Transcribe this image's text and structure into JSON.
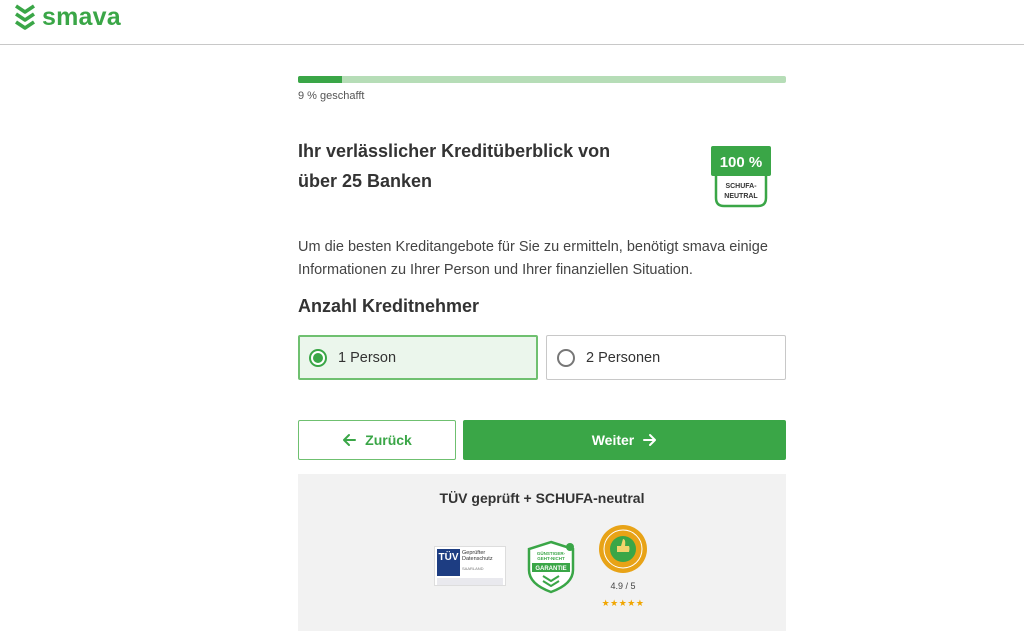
{
  "brand": {
    "name": "smava",
    "accent_color": "#3aa647",
    "light_accent": "#b6ddb7",
    "icon": "smava-chevrons-logo"
  },
  "progress": {
    "percent": 9,
    "label": "9 % geschafft"
  },
  "headline": {
    "line1": "Ihr verlässlicher Kreditüberblick von",
    "line2": "über 25 Banken"
  },
  "badge": {
    "value": "100 %",
    "line1": "SCHUFA-",
    "line2": "NEUTRAL"
  },
  "intro_text": "Um die besten Kreditangebote für Sie zu ermitteln, benötigt smava einige Informationen zu Ihrer Person und Ihrer finanziellen Situation.",
  "borrowers": {
    "title": "Anzahl Kreditnehmer",
    "options": [
      {
        "label": "1 Person",
        "selected": true
      },
      {
        "label": "2 Personen",
        "selected": false
      }
    ]
  },
  "buttons": {
    "back": "Zurück",
    "next": "Weiter"
  },
  "trust": {
    "title": "TÜV geprüft + SCHUFA-neutral",
    "tuv": {
      "logo": "TÜV",
      "line1": "Geprüfter",
      "line2": "Datenschutz",
      "sub": "SAARLAND"
    },
    "garantie": {
      "line1": "GÜNSTIGER-",
      "line2": "GEHT-NICHT",
      "label": "GARANTIE"
    },
    "rating": "4.9 / 5",
    "stars": "★★★★★",
    "star_color": "#f0a500"
  }
}
